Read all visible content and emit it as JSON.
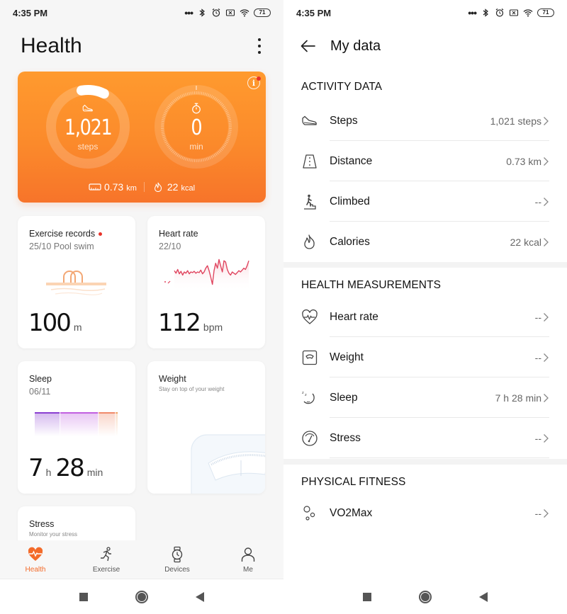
{
  "status_bar": {
    "time": "4:35 PM",
    "battery": "71"
  },
  "left_screen": {
    "title": "Health",
    "activity_card": {
      "steps_value": "1,021",
      "steps_unit": "steps",
      "steps_goal_progress": 0.1,
      "minutes_value": "0",
      "minutes_unit": "min",
      "distance_value": "0.73",
      "distance_unit": "km",
      "calories_value": "22",
      "calories_unit": "kcal"
    },
    "tiles": {
      "exercise": {
        "title": "Exercise records",
        "subtitle": "25/10 Pool swim",
        "value": "100",
        "unit": "m"
      },
      "heart_rate": {
        "title": "Heart rate",
        "subtitle": "22/10",
        "value": "112",
        "unit": "bpm",
        "trend": [
          62,
          58,
          64,
          57,
          61,
          55,
          60,
          58,
          62,
          57,
          60,
          59,
          61,
          58,
          60,
          59,
          63,
          57,
          60,
          66,
          70,
          62,
          52,
          40,
          62,
          74,
          66,
          80,
          70,
          60,
          78,
          76,
          64,
          58,
          55,
          60,
          58,
          56,
          59,
          62,
          60,
          63,
          66,
          64,
          70,
          78
        ]
      },
      "sleep": {
        "title": "Sleep",
        "subtitle": "06/11",
        "hours": "7",
        "hours_unit": "h",
        "minutes": "28",
        "minutes_unit": "min",
        "segments": [
          {
            "stage": "deep",
            "share": 0.3,
            "color": "#8a3fd1"
          },
          {
            "stage": "light",
            "share": 0.45,
            "color": "#c160e0"
          },
          {
            "stage": "rem",
            "share": 0.2,
            "color": "#f08a6a"
          },
          {
            "stage": "awake",
            "share": 0.03,
            "color": "#f0a060"
          }
        ]
      },
      "weight": {
        "title": "Weight",
        "hint": "Stay on top of your weight"
      },
      "stress": {
        "title": "Stress",
        "hint": "Monitor your stress"
      }
    },
    "bottom_nav": [
      {
        "label": "Health",
        "icon": "heart-pulse-icon",
        "active": true
      },
      {
        "label": "Exercise",
        "icon": "runner-icon",
        "active": false
      },
      {
        "label": "Devices",
        "icon": "watch-icon",
        "active": false
      },
      {
        "label": "Me",
        "icon": "person-icon",
        "active": false
      }
    ]
  },
  "right_screen": {
    "title": "My data",
    "sections": [
      {
        "title": "ACTIVITY DATA",
        "rows": [
          {
            "label": "Steps",
            "value": "1,021 steps",
            "icon": "shoe-icon"
          },
          {
            "label": "Distance",
            "value": "0.73 km",
            "icon": "road-icon"
          },
          {
            "label": "Climbed",
            "value": "--",
            "icon": "stairs-climber-icon"
          },
          {
            "label": "Calories",
            "value": "22 kcal",
            "icon": "flame-icon"
          }
        ]
      },
      {
        "title": "HEALTH MEASUREMENTS",
        "rows": [
          {
            "label": "Heart rate",
            "value": "--",
            "icon": "heart-pulse-icon"
          },
          {
            "label": "Weight",
            "value": "--",
            "icon": "scale-icon"
          },
          {
            "label": "Sleep",
            "value": "7 h 28 min",
            "icon": "moon-zz-icon"
          },
          {
            "label": "Stress",
            "value": "--",
            "icon": "gauge-icon"
          }
        ]
      },
      {
        "title": "PHYSICAL FITNESS",
        "rows": [
          {
            "label": "VO2Max",
            "value": "--",
            "icon": "bubbles-icon"
          }
        ]
      }
    ]
  },
  "colors": {
    "accent": "#f36b2a",
    "card_orange_top": "#ff9a2e",
    "card_orange_bottom": "#f7742a",
    "heart_line": "#e0455f",
    "alert_dot": "#e8332a"
  }
}
